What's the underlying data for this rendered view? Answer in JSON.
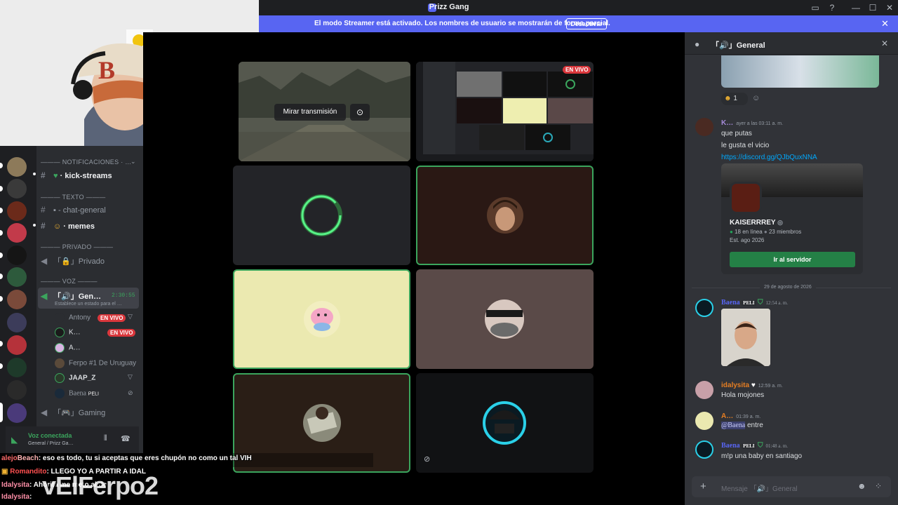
{
  "window": {
    "title": "Prizz Gang"
  },
  "banner": {
    "text": "El modo Streamer está activado. Los nombres de usuario se mostrarán de forma parcial.",
    "button": "Desactivar"
  },
  "channels": {
    "cat_notif": "——— NOTIFICACIONES · …",
    "kick": "kick-streams",
    "cat_text": "——— TEXTO ———",
    "general": "chat-general",
    "memes": "memes",
    "cat_priv": "——— PRIVADO ———",
    "privado": "Privado",
    "cat_voz": "——— VOZ ———",
    "voice_general": "Gen…",
    "voice_timer": "2:30:55",
    "voice_status": "Establece un estado para el …",
    "users": [
      {
        "name": "Antony",
        "live": "EN VIVO"
      },
      {
        "name": "K…",
        "live": "EN VIVO"
      },
      {
        "name": "A…",
        "live": ""
      },
      {
        "name": "Ferpo #1 De Uruguay",
        "live": ""
      },
      {
        "name": "JAAP_Z",
        "live": ""
      },
      {
        "name": "Baena",
        "tag": "PELI"
      }
    ],
    "gaming": "Gaming",
    "voice_connected": "Voz conectada",
    "voice_path": "General / Prizz Ga…"
  },
  "stage": {
    "watch_button": "Mirar transmisión",
    "live_badge": "EN VIVO"
  },
  "chat": {
    "header": "General",
    "reaction_count": "1",
    "messages": [
      {
        "name": "K…",
        "time": "ayer a las 03:11 a. m.",
        "lines": [
          "que putas",
          "le gusta el vicio"
        ],
        "link": "https://discord.gg/QJbQuxNNA"
      }
    ],
    "invite": {
      "server": "KAISERRREY",
      "online": "18 en línea",
      "members": "23 miembros",
      "est": "Est. ago 2026",
      "button": "Ir al servidor"
    },
    "date_divider": "29 de agosto de 2026",
    "m2": {
      "name": "Baena",
      "tag": "PELI",
      "time": "12:54 a. m."
    },
    "m3": {
      "name": "idalysita",
      "time": "12:59 a. m.",
      "text": "Hola mojones"
    },
    "m4": {
      "name": "A…",
      "time": "01:39 a. m.",
      "mention": "@Baena",
      "text": " entre"
    },
    "m5": {
      "name": "Baena",
      "tag": "PELI",
      "time": "01:48 a. m.",
      "text": "m!p una baby en santiago"
    },
    "composer_placeholder": "Mensaje",
    "composer_channel": "General"
  },
  "overlay": [
    {
      "user": "alejo",
      "user2": "Beach",
      "text": ": eso es todo, tu si aceptas que eres chupón no como un tal VIH"
    },
    {
      "user": "Romandito",
      "text": ": LLEGO YO A PARTIR A IDAL"
    },
    {
      "user": "Idalysita",
      "text": ": Ahorita me meto al dc"
    },
    {
      "user": "Idalysita",
      "text": ":"
    }
  ],
  "overlay_big": "vElFerpo2",
  "colors": {
    "blurple": "#5865f2",
    "green": "#3ba55d",
    "live_red": "#da373c"
  }
}
